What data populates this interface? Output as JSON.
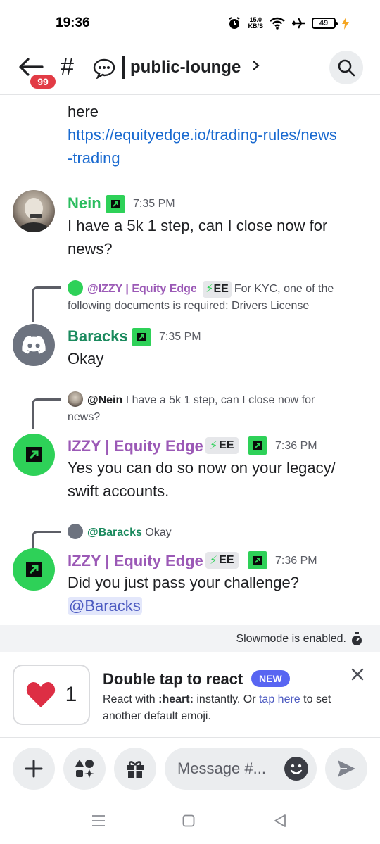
{
  "status_bar": {
    "time": "19:36",
    "net_speed_value": "15.0",
    "net_speed_unit": "KB/S",
    "battery": "49",
    "icons": [
      "alarm-icon",
      "wifi-icon",
      "airplane-icon",
      "battery-icon",
      "charging-icon"
    ]
  },
  "header": {
    "back_badge": "99",
    "channel_prefix": "#",
    "channel_name": "public-lounge",
    "icons": [
      "back-arrow-icon",
      "speech-bubble-icon",
      "chevron-right-icon",
      "search-icon"
    ]
  },
  "messages": {
    "continuation": {
      "line1": "here",
      "link_line1": "https://equityedge.io/trading-rules/news",
      "link_line2": "-trading"
    },
    "m1": {
      "author": "Nein",
      "time": "7:35 PM",
      "line1": "I have a 5k 1 step, can I close now for",
      "line2": "news?"
    },
    "m2": {
      "reply_author": "@IZZY | Equity Edge",
      "reply_tag": "EE",
      "reply_text1": "For KYC, one of the",
      "reply_text2": "following documents is required: Drivers License",
      "author": "Baracks",
      "time": "7:35 PM",
      "line1": "Okay"
    },
    "m3": {
      "reply_author": "@Nein",
      "reply_text1": "I have a 5k 1 step, can I close now for",
      "reply_text2": "news?",
      "author": "IZZY | Equity Edge",
      "tag": "EE",
      "time": "7:36 PM",
      "line1": "Yes you can do so now on your legacy/",
      "line2": "swift accounts."
    },
    "m4": {
      "reply_author": "@Baracks",
      "reply_text1": "Okay",
      "author": "IZZY | Equity Edge",
      "tag": "EE",
      "time": "7:36 PM",
      "line1": "Did you just pass your challenge?",
      "mention": "@Baracks"
    }
  },
  "slowmode": {
    "text": "Slowmode is enabled."
  },
  "react_tip": {
    "count": "1",
    "title": "Double tap to react",
    "new_badge": "NEW",
    "body_pre": "React with ",
    "body_emoji": ":heart:",
    "body_mid": " instantly. Or ",
    "body_link": "tap here",
    "body_post": " to set another default emoji."
  },
  "composer": {
    "placeholder": "Message #..."
  },
  "colors": {
    "nein": "#2bbd5f",
    "baracks": "#1b8a5e",
    "izzy": "#9b59b6",
    "link": "#1a6ad0",
    "mention_bg": "#e3e7fb",
    "badge_red": "#e23b45",
    "new_blue": "#5865f2",
    "equity_green": "#2ed158"
  }
}
